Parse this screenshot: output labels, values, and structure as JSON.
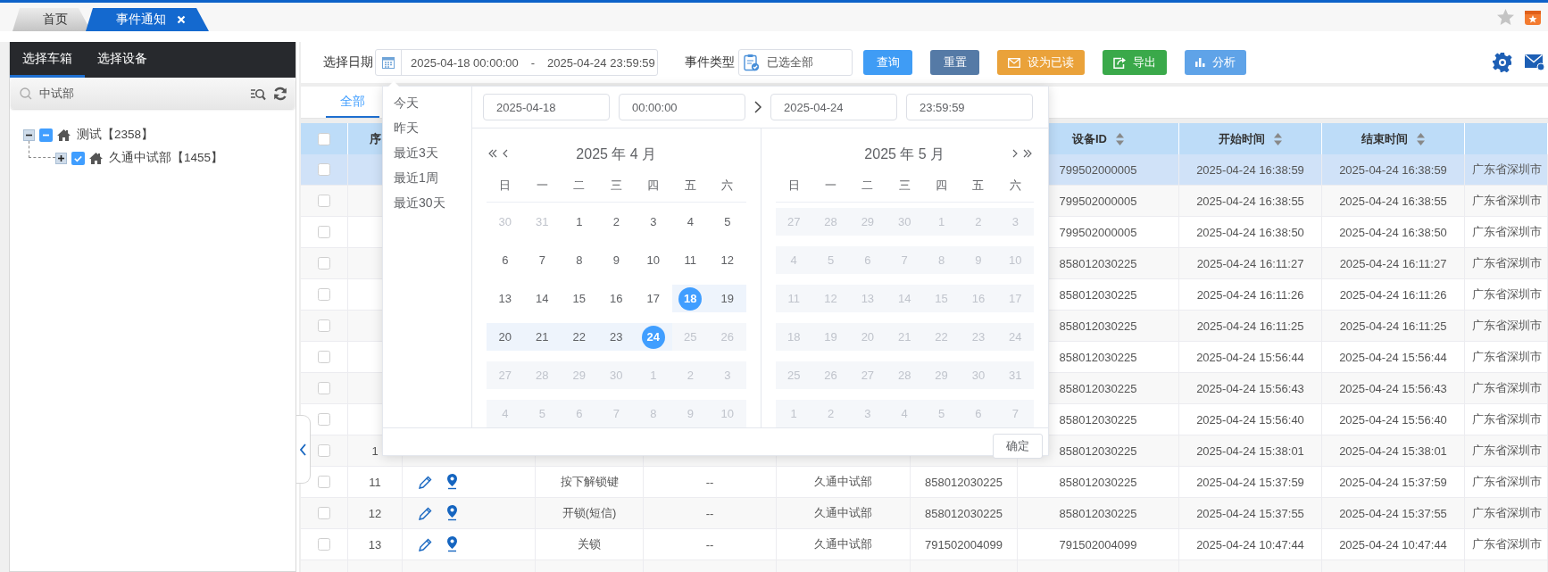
{
  "top_tabs": [
    {
      "label": "首页",
      "selected": false,
      "closable": false
    },
    {
      "label": "事件通知",
      "selected": true,
      "closable": true
    }
  ],
  "sidebar": {
    "tabs": [
      {
        "label": "选择车箱",
        "selected": true
      },
      {
        "label": "选择设备",
        "selected": false
      }
    ],
    "search": {
      "value": "中试部"
    },
    "tree": [
      {
        "label": "测试【2358】",
        "expanded": true,
        "checked": false,
        "indeterminate": true,
        "children": [
          {
            "label": "久通中试部【1455】",
            "expanded": false,
            "checked": true
          }
        ]
      }
    ]
  },
  "toolbar": {
    "date_label": "选择日期",
    "date_range": {
      "start": "2025-04-18 00:00:00",
      "separator": "-",
      "end": "2025-04-24 23:59:59"
    },
    "type_label": "事件类型",
    "type_value": "已选全部",
    "buttons": [
      {
        "label": "查询",
        "color": "#3f9cf5"
      },
      {
        "label": "重置",
        "color": "#557aa6"
      },
      {
        "label": "设为已读",
        "color": "#eaa23a"
      },
      {
        "label": "导出",
        "color": "#3aa94a"
      },
      {
        "label": "分析",
        "color": "#5fa3e8"
      }
    ]
  },
  "filter_tabs": [
    {
      "label": "全部",
      "selected": true
    }
  ],
  "table": {
    "all_checked": false,
    "columns": {
      "index": {
        "label": "序",
        "sortable": false
      },
      "device_id": {
        "label": "设备ID",
        "sortable": true
      },
      "start_time": {
        "label": "开始时间",
        "sortable": true
      },
      "end_time": {
        "label": "结束时间",
        "sortable": true
      }
    },
    "rows": [
      {
        "selected": true,
        "checked": false,
        "actions": false,
        "device_id": "799502000005",
        "start_time": "2025-04-24 16:38:59",
        "end_time": "2025-04-24 16:38:59",
        "column_11": "广东省深圳市"
      },
      {
        "selected": false,
        "checked": false,
        "actions": false,
        "device_id": "799502000005",
        "start_time": "2025-04-24 16:38:55",
        "end_time": "2025-04-24 16:38:55",
        "column_11": "广东省深圳市"
      },
      {
        "selected": false,
        "checked": false,
        "actions": false,
        "device_id": "799502000005",
        "start_time": "2025-04-24 16:38:50",
        "end_time": "2025-04-24 16:38:50",
        "column_11": "广东省深圳市"
      },
      {
        "selected": false,
        "checked": false,
        "actions": false,
        "device_id": "858012030225",
        "start_time": "2025-04-24 16:11:27",
        "end_time": "2025-04-24 16:11:27",
        "column_11": "广东省深圳市"
      },
      {
        "selected": false,
        "checked": false,
        "actions": false,
        "device_id": "858012030225",
        "start_time": "2025-04-24 16:11:26",
        "end_time": "2025-04-24 16:11:26",
        "column_11": "广东省深圳市"
      },
      {
        "selected": false,
        "checked": false,
        "actions": false,
        "device_id": "858012030225",
        "start_time": "2025-04-24 16:11:25",
        "end_time": "2025-04-24 16:11:25",
        "column_11": "广东省深圳市"
      },
      {
        "selected": false,
        "checked": false,
        "actions": false,
        "device_id": "858012030225",
        "start_time": "2025-04-24 15:56:44",
        "end_time": "2025-04-24 15:56:44",
        "column_11": "广东省深圳市"
      },
      {
        "selected": false,
        "checked": false,
        "actions": false,
        "device_id": "858012030225",
        "start_time": "2025-04-24 15:56:43",
        "end_time": "2025-04-24 15:56:43",
        "column_11": "广东省深圳市"
      },
      {
        "selected": false,
        "checked": false,
        "actions": false,
        "device_id": "858012030225",
        "start_time": "2025-04-24 15:56:40",
        "end_time": "2025-04-24 15:56:40",
        "column_11": "广东省深圳市"
      },
      {
        "selected": false,
        "checked": false,
        "actions": false,
        "index": "1",
        "device_id": "858012030225",
        "start_time": "2025-04-24 15:38:01",
        "end_time": "2025-04-24 15:38:01",
        "column_11": "广东省深圳市"
      },
      {
        "selected": false,
        "checked": false,
        "actions": true,
        "index": "11",
        "column_4": "按下解锁键",
        "column_5": "--",
        "column_6": "久通中试部",
        "column_7": "858012030225",
        "device_id": "858012030225",
        "start_time": "2025-04-24 15:37:59",
        "end_time": "2025-04-24 15:37:59",
        "column_11": "广东省深圳市"
      },
      {
        "selected": false,
        "checked": false,
        "actions": true,
        "index": "12",
        "column_4": "开锁(短信)",
        "column_5": "--",
        "column_6": "久通中试部",
        "column_7": "858012030225",
        "device_id": "858012030225",
        "start_time": "2025-04-24 15:37:55",
        "end_time": "2025-04-24 15:37:55",
        "column_11": "广东省深圳市"
      },
      {
        "selected": false,
        "checked": false,
        "actions": true,
        "index": "13",
        "column_4": "关锁",
        "column_5": "--",
        "column_6": "久通中试部",
        "column_7": "791502004099",
        "device_id": "791502004099",
        "start_time": "2025-04-24 10:47:44",
        "end_time": "2025-04-24 10:47:44",
        "column_11": "广东省深圳市"
      }
    ]
  },
  "date_picker": {
    "shortcuts": [
      "今天",
      "昨天",
      "最近3天",
      "最近1周",
      "最近30天"
    ],
    "start_date": "2025-04-18",
    "start_time": "00:00:00",
    "end_date": "2025-04-24",
    "end_time": "23:59:59",
    "months": [
      {
        "title": "2025 年 4 月",
        "weekdays": [
          "日",
          "一",
          "二",
          "三",
          "四",
          "五",
          "六"
        ],
        "weeks": [
          [
            {
              "day": "30",
              "kind": "other",
              "selected": false
            },
            {
              "day": "31",
              "kind": "other",
              "selected": false
            },
            {
              "day": "1",
              "kind": "normal",
              "selected": false
            },
            {
              "day": "2",
              "kind": "normal",
              "selected": false
            },
            {
              "day": "3",
              "kind": "normal",
              "selected": false
            },
            {
              "day": "4",
              "kind": "normal",
              "selected": false
            },
            {
              "day": "5",
              "kind": "normal",
              "selected": false
            }
          ],
          [
            {
              "day": "6",
              "kind": "normal",
              "selected": false
            },
            {
              "day": "7",
              "kind": "normal",
              "selected": false
            },
            {
              "day": "8",
              "kind": "normal",
              "selected": false
            },
            {
              "day": "9",
              "kind": "normal",
              "selected": false
            },
            {
              "day": "10",
              "kind": "normal",
              "selected": false
            },
            {
              "day": "11",
              "kind": "normal",
              "selected": false
            },
            {
              "day": "12",
              "kind": "normal",
              "selected": false
            }
          ],
          [
            {
              "day": "13",
              "kind": "normal",
              "selected": false
            },
            {
              "day": "14",
              "kind": "normal",
              "selected": false
            },
            {
              "day": "15",
              "kind": "normal",
              "selected": false
            },
            {
              "day": "16",
              "kind": "normal",
              "selected": false
            },
            {
              "day": "17",
              "kind": "normal",
              "selected": false
            },
            {
              "day": "18",
              "kind": "range",
              "selected": true
            },
            {
              "day": "19",
              "kind": "range",
              "selected": false
            }
          ],
          [
            {
              "day": "20",
              "kind": "range",
              "selected": false
            },
            {
              "day": "21",
              "kind": "range",
              "selected": false
            },
            {
              "day": "22",
              "kind": "range",
              "selected": false
            },
            {
              "day": "23",
              "kind": "range",
              "selected": false
            },
            {
              "day": "24",
              "kind": "range",
              "selected": true
            },
            {
              "day": "25",
              "kind": "disabled",
              "selected": false
            },
            {
              "day": "26",
              "kind": "disabled",
              "selected": false
            }
          ],
          [
            {
              "day": "27",
              "kind": "disabled",
              "selected": false
            },
            {
              "day": "28",
              "kind": "disabled",
              "selected": false
            },
            {
              "day": "29",
              "kind": "disabled",
              "selected": false
            },
            {
              "day": "30",
              "kind": "disabled",
              "selected": false
            },
            {
              "day": "1",
              "kind": "disabled",
              "selected": false
            },
            {
              "day": "2",
              "kind": "disabled",
              "selected": false
            },
            {
              "day": "3",
              "kind": "disabled",
              "selected": false
            }
          ],
          [
            {
              "day": "4",
              "kind": "disabled",
              "selected": false
            },
            {
              "day": "5",
              "kind": "disabled",
              "selected": false
            },
            {
              "day": "6",
              "kind": "disabled",
              "selected": false
            },
            {
              "day": "7",
              "kind": "disabled",
              "selected": false
            },
            {
              "day": "8",
              "kind": "disabled",
              "selected": false
            },
            {
              "day": "9",
              "kind": "disabled",
              "selected": false
            },
            {
              "day": "10",
              "kind": "disabled",
              "selected": false
            }
          ]
        ]
      },
      {
        "title": "2025 年 5 月",
        "weekdays": [
          "日",
          "一",
          "二",
          "三",
          "四",
          "五",
          "六"
        ],
        "weeks": [
          [
            {
              "day": "27",
              "kind": "disabled",
              "selected": false
            },
            {
              "day": "28",
              "kind": "disabled",
              "selected": false
            },
            {
              "day": "29",
              "kind": "disabled",
              "selected": false
            },
            {
              "day": "30",
              "kind": "disabled",
              "selected": false
            },
            {
              "day": "1",
              "kind": "disabled",
              "selected": false
            },
            {
              "day": "2",
              "kind": "disabled",
              "selected": false
            },
            {
              "day": "3",
              "kind": "disabled",
              "selected": false
            }
          ],
          [
            {
              "day": "4",
              "kind": "disabled",
              "selected": false
            },
            {
              "day": "5",
              "kind": "disabled",
              "selected": false
            },
            {
              "day": "6",
              "kind": "disabled",
              "selected": false
            },
            {
              "day": "7",
              "kind": "disabled",
              "selected": false
            },
            {
              "day": "8",
              "kind": "disabled",
              "selected": false
            },
            {
              "day": "9",
              "kind": "disabled",
              "selected": false
            },
            {
              "day": "10",
              "kind": "disabled",
              "selected": false
            }
          ],
          [
            {
              "day": "11",
              "kind": "disabled",
              "selected": false
            },
            {
              "day": "12",
              "kind": "disabled",
              "selected": false
            },
            {
              "day": "13",
              "kind": "disabled",
              "selected": false
            },
            {
              "day": "14",
              "kind": "disabled",
              "selected": false
            },
            {
              "day": "15",
              "kind": "disabled",
              "selected": false
            },
            {
              "day": "16",
              "kind": "disabled",
              "selected": false
            },
            {
              "day": "17",
              "kind": "disabled",
              "selected": false
            }
          ],
          [
            {
              "day": "18",
              "kind": "disabled",
              "selected": false
            },
            {
              "day": "19",
              "kind": "disabled",
              "selected": false
            },
            {
              "day": "20",
              "kind": "disabled",
              "selected": false
            },
            {
              "day": "21",
              "kind": "disabled",
              "selected": false
            },
            {
              "day": "22",
              "kind": "disabled",
              "selected": false
            },
            {
              "day": "23",
              "kind": "disabled",
              "selected": false
            },
            {
              "day": "24",
              "kind": "disabled",
              "selected": false
            }
          ],
          [
            {
              "day": "25",
              "kind": "disabled",
              "selected": false
            },
            {
              "day": "26",
              "kind": "disabled",
              "selected": false
            },
            {
              "day": "27",
              "kind": "disabled",
              "selected": false
            },
            {
              "day": "28",
              "kind": "disabled",
              "selected": false
            },
            {
              "day": "29",
              "kind": "disabled",
              "selected": false
            },
            {
              "day": "30",
              "kind": "disabled",
              "selected": false
            },
            {
              "day": "31",
              "kind": "disabled",
              "selected": false
            }
          ],
          [
            {
              "day": "1",
              "kind": "disabled",
              "selected": false
            },
            {
              "day": "2",
              "kind": "disabled",
              "selected": false
            },
            {
              "day": "3",
              "kind": "disabled",
              "selected": false
            },
            {
              "day": "4",
              "kind": "disabled",
              "selected": false
            },
            {
              "day": "5",
              "kind": "disabled",
              "selected": false
            },
            {
              "day": "6",
              "kind": "disabled",
              "selected": false
            },
            {
              "day": "7",
              "kind": "disabled",
              "selected": false
            }
          ]
        ]
      }
    ],
    "confirm": "确定"
  }
}
